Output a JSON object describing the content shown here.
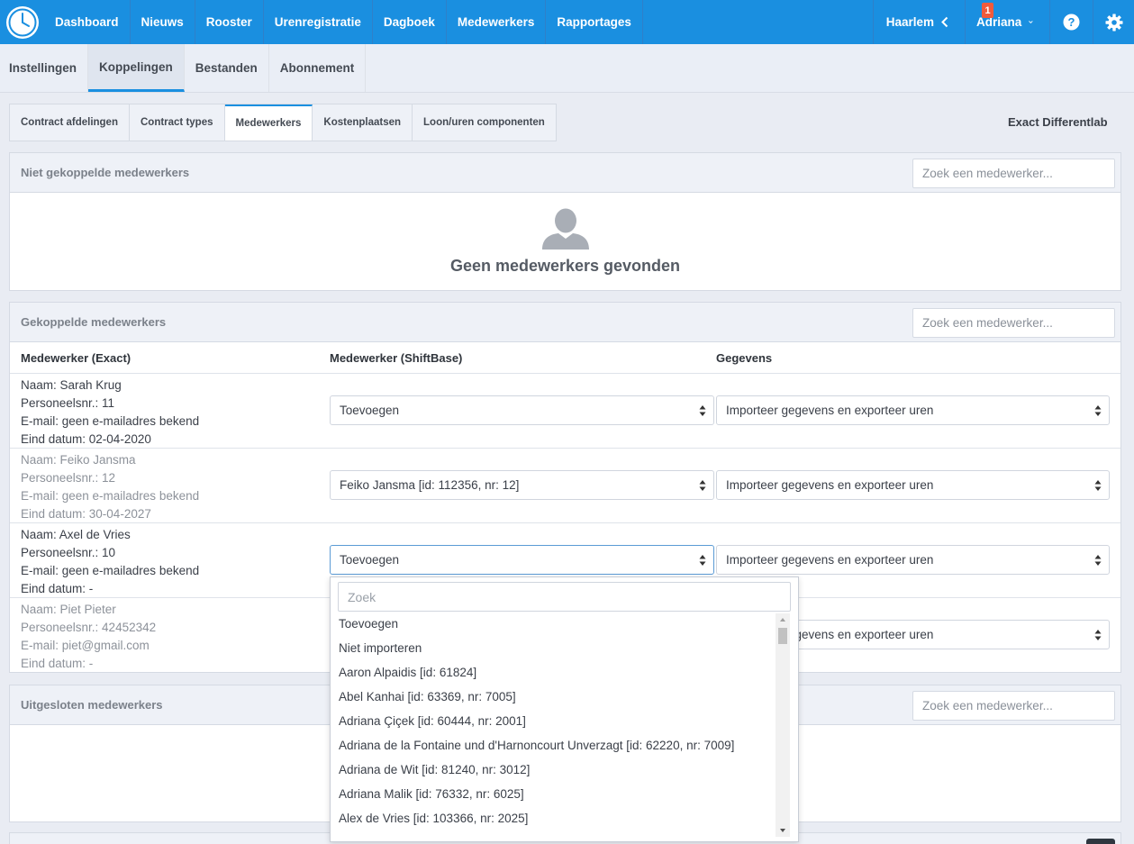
{
  "nav": {
    "items": [
      "Dashboard",
      "Nieuws",
      "Rooster",
      "Urenregistratie",
      "Dagboek",
      "Medewerkers",
      "Rapportages"
    ],
    "location": "Haarlem",
    "user": "Adriana",
    "notification_count": "1"
  },
  "subnav": {
    "items": [
      "Instellingen",
      "Koppelingen",
      "Bestanden",
      "Abonnement"
    ],
    "active": "Koppelingen"
  },
  "tabs": {
    "items": [
      "Contract afdelingen",
      "Contract types",
      "Medewerkers",
      "Kostenplaatsen",
      "Loon/uren componenten"
    ],
    "active": "Medewerkers"
  },
  "company": "Exact Differentlab",
  "unlinked": {
    "title": "Niet gekoppelde medewerkers",
    "search_placeholder": "Zoek een medewerker...",
    "empty_text": "Geen medewerkers gevonden"
  },
  "linked": {
    "title": "Gekoppelde medewerkers",
    "search_placeholder": "Zoek een medewerker...",
    "columns": [
      "Medewerker (Exact)",
      "Medewerker (ShiftBase)",
      "Gegevens"
    ],
    "rows": [
      {
        "naam": "Naam: Sarah Krug",
        "nr": "Personeelsnr.: 11",
        "email": "E-mail: geen e-mailadres bekend",
        "eind": "Eind datum: 02-04-2020",
        "shiftbase": "Toevoegen",
        "gegevens": "Importeer gegevens en exporteer uren"
      },
      {
        "naam": "Naam: Feiko Jansma",
        "nr": "Personeelsnr.: 12",
        "email": "E-mail: geen e-mailadres bekend",
        "eind": "Eind datum: 30-04-2027",
        "shiftbase": "Feiko Jansma [id: 112356, nr: 12]",
        "gegevens": "Importeer gegevens en exporteer uren"
      },
      {
        "naam": "Naam: Axel de Vries",
        "nr": "Personeelsnr.: 10",
        "email": "E-mail: geen e-mailadres bekend",
        "eind": "Eind datum: -",
        "shiftbase": "Toevoegen",
        "gegevens": "Importeer gegevens en exporteer uren"
      },
      {
        "naam": "Naam: Piet Pieter",
        "nr": "Personeelsnr.: 42452342",
        "email": "E-mail: piet@gmail.com",
        "eind": "Eind datum: -",
        "shiftbase": "",
        "gegevens": "Importeer gegevens en exporteer uren"
      }
    ]
  },
  "excluded": {
    "title": "Uitgesloten medewerkers",
    "search_placeholder": "Zoek een medewerker..."
  },
  "dropdown": {
    "search_placeholder": "Zoek",
    "options": [
      "Toevoegen",
      "Niet importeren",
      "Aaron Alpaidis [id: 61824]",
      "Abel Kanhai [id: 63369, nr: 7005]",
      "Adriana Çiçek [id: 60444, nr: 2001]",
      "Adriana de la Fontaine und d'Harnoncourt Unverzagt [id: 62220, nr: 7009]",
      "Adriana de Wit [id: 81240, nr: 3012]",
      "Adriana Malik [id: 76332, nr: 6025]",
      "Alex de Vries [id: 103366, nr: 2025]"
    ]
  }
}
